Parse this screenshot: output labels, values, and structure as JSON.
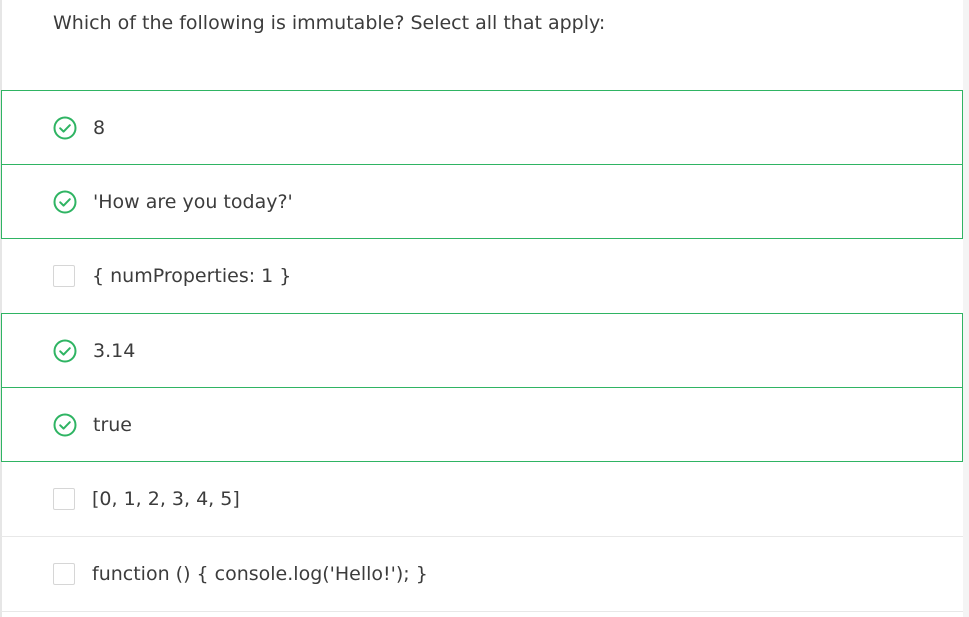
{
  "question": {
    "text": "Which of the following is immutable? Select all that apply:"
  },
  "options": [
    {
      "label": "8",
      "selected": true
    },
    {
      "label": "'How are you today?'",
      "selected": true
    },
    {
      "label": "{ numProperties: 1 }",
      "selected": false
    },
    {
      "label": "3.14",
      "selected": true
    },
    {
      "label": "true",
      "selected": true
    },
    {
      "label": "[0, 1, 2, 3, 4, 5]",
      "selected": false
    },
    {
      "label": "function () { console.log('Hello!'); }",
      "selected": false
    }
  ],
  "colors": {
    "accent": "#2fb463",
    "text": "#3c3c3c",
    "divider": "#e8e8e8",
    "checkbox_border": "#d6d6d6"
  },
  "icons": {
    "selected": "check-circle-icon",
    "unselected": "empty-checkbox-icon"
  }
}
